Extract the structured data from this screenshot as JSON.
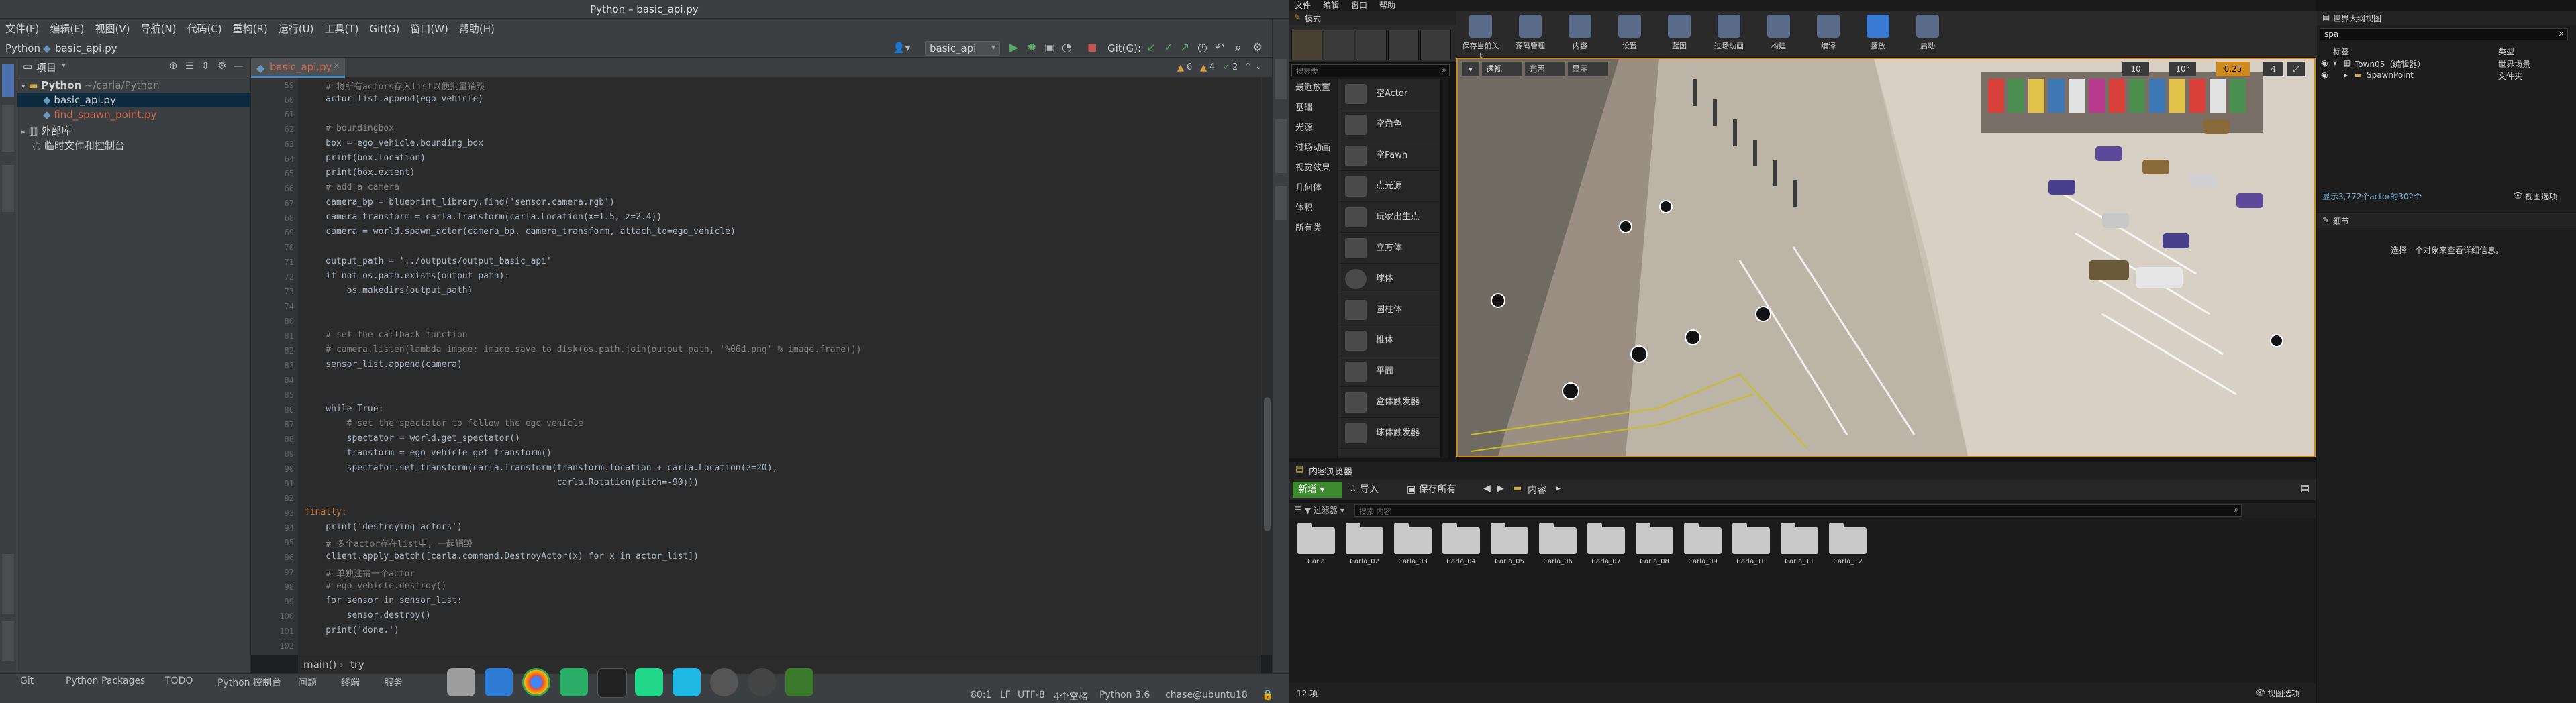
{
  "ide": {
    "window_title": "Python – basic_api.py",
    "menu": [
      "文件(F)",
      "编辑(E)",
      "视图(V)",
      "导航(N)",
      "代码(C)",
      "重构(R)",
      "运行(U)",
      "工具(T)",
      "Git(G)",
      "窗口(W)",
      "帮助(H)"
    ],
    "nav": {
      "project": "Python",
      "file": "basic_api.py",
      "run_config": "basic_api",
      "git_label": "Git(G):"
    },
    "project_panel": {
      "title": "项目",
      "root": "Python",
      "root_path": "~/carla/Python",
      "files": [
        "basic_api.py",
        "find_spawn_point.py"
      ],
      "external": "外部库",
      "scratch": "临时文件和控制台"
    },
    "editor_tab": "basic_api.py",
    "inspection": {
      "warnings": "6",
      "weak": "4",
      "typos": "2"
    },
    "code_lines": [
      {
        "n": "59",
        "t": "    # 将所有actors存入list以便批量销毁",
        "c": "cm"
      },
      {
        "n": "60",
        "t": "    actor_list.append(ego_vehicle)",
        "c": ""
      },
      {
        "n": "61",
        "t": "",
        "c": ""
      },
      {
        "n": "62",
        "t": "    # boundingbox",
        "c": "cm"
      },
      {
        "n": "63",
        "t": "    box = ego_vehicle.bounding_box",
        "c": ""
      },
      {
        "n": "64",
        "t": "    print(box.location)",
        "c": ""
      },
      {
        "n": "65",
        "t": "    print(box.extent)",
        "c": ""
      },
      {
        "n": "66",
        "t": "    # add a camera",
        "c": "cm"
      },
      {
        "n": "67",
        "t": "    camera_bp = blueprint_library.find('sensor.camera.rgb')",
        "c": ""
      },
      {
        "n": "68",
        "t": "    camera_transform = carla.Transform(carla.Location(x=1.5, z=2.4))",
        "c": ""
      },
      {
        "n": "69",
        "t": "    camera = world.spawn_actor(camera_bp, camera_transform, attach_to=ego_vehicle)",
        "c": ""
      },
      {
        "n": "70",
        "t": "",
        "c": ""
      },
      {
        "n": "71",
        "t": "    output_path = '../outputs/output_basic_api'",
        "c": ""
      },
      {
        "n": "72",
        "t": "    if not os.path.exists(output_path):",
        "c": ""
      },
      {
        "n": "73",
        "t": "        os.makedirs(output_path)",
        "c": ""
      },
      {
        "n": "74",
        "t": "",
        "c": ""
      },
      {
        "n": "80",
        "t": "",
        "c": ""
      },
      {
        "n": "81",
        "t": "    # set the callback function",
        "c": "cm"
      },
      {
        "n": "82",
        "t": "    # camera.listen(lambda image: image.save_to_disk(os.path.join(output_path, '%06d.png' % image.frame)))",
        "c": "cm"
      },
      {
        "n": "83",
        "t": "    sensor_list.append(camera)",
        "c": ""
      },
      {
        "n": "84",
        "t": "",
        "c": ""
      },
      {
        "n": "85",
        "t": "",
        "c": ""
      },
      {
        "n": "86",
        "t": "    while True:",
        "c": ""
      },
      {
        "n": "87",
        "t": "        # set the spectator to follow the ego vehicle",
        "c": "cm"
      },
      {
        "n": "88",
        "t": "        spectator = world.get_spectator()",
        "c": ""
      },
      {
        "n": "89",
        "t": "        transform = ego_vehicle.get_transform()",
        "c": ""
      },
      {
        "n": "90",
        "t": "        spectator.set_transform(carla.Transform(transform.location + carla.Location(z=20),",
        "c": ""
      },
      {
        "n": "91",
        "t": "                                                carla.Rotation(pitch=-90)))",
        "c": ""
      },
      {
        "n": "92",
        "t": "",
        "c": ""
      },
      {
        "n": "93",
        "t": "finally:",
        "c": "kw"
      },
      {
        "n": "94",
        "t": "    print('destroying actors')",
        "c": ""
      },
      {
        "n": "95",
        "t": "    # 多个actor存在list中, 一起销毁",
        "c": "cm"
      },
      {
        "n": "96",
        "t": "    client.apply_batch([carla.command.DestroyActor(x) for x in actor_list])",
        "c": ""
      },
      {
        "n": "97",
        "t": "    # 单独注销一个actor",
        "c": "cm"
      },
      {
        "n": "98",
        "t": "    # ego_vehicle.destroy()",
        "c": "cm"
      },
      {
        "n": "99",
        "t": "    for sensor in sensor_list:",
        "c": ""
      },
      {
        "n": "100",
        "t": "        sensor.destroy()",
        "c": ""
      },
      {
        "n": "101",
        "t": "    print('done.')",
        "c": ""
      },
      {
        "n": "102",
        "t": "",
        "c": ""
      }
    ],
    "breadcrumb": [
      "main()",
      "try"
    ],
    "tool_windows": [
      "Git",
      "Python Packages",
      "TODO",
      "Python 控制台",
      "问题",
      "终端",
      "服务"
    ],
    "status": {
      "position": "80:1",
      "line_sep": "LF",
      "encoding": "UTF-8",
      "indent": "4个空格",
      "interpreter": "Python 3.6",
      "user": "chase@ubuntu18"
    }
  },
  "ue": {
    "menu": [
      "文件",
      "编辑",
      "窗口",
      "帮助"
    ],
    "modes_tab": "模式",
    "place_search_placeholder": "搜索类",
    "place_categories": [
      "最近放置",
      "基础",
      "光源",
      "过场动画",
      "视觉效果",
      "几何体",
      "体积",
      "所有类"
    ],
    "place_items": [
      "空Actor",
      "空角色",
      "空Pawn",
      "点光源",
      "玩家出生点",
      "立方体",
      "球体",
      "圆柱体",
      "椎体",
      "平面",
      "盒体触发器",
      "球体触发器"
    ],
    "toolbar": [
      "保存当前关卡",
      "源码管理",
      "内容",
      "设置",
      "蓝图",
      "过场动画",
      "构建",
      "编译",
      "播放",
      "启动"
    ],
    "viewport": {
      "mode_perspective": "透视",
      "mode_lit": "光照",
      "mode_show": "显示",
      "snap_grid": "10",
      "snap_rot": "10°",
      "snap_scale": "0.25",
      "camera_speed": "4"
    },
    "content_browser": {
      "tab": "内容浏览器",
      "add_new": "新增",
      "import": "导入",
      "save_all": "保存所有",
      "path": "内容",
      "filter": "过滤器",
      "search_placeholder": "搜索 内容",
      "folders": [
        "Carla",
        "Carla_02",
        "Carla_03",
        "Carla_04",
        "Carla_05",
        "Carla_06",
        "Carla_07",
        "Carla_08",
        "Carla_09",
        "Carla_10",
        "Carla_11",
        "Carla_12"
      ],
      "item_count": "12 项",
      "view_options": "视图选项"
    },
    "outliner": {
      "tab": "世界大纲视图",
      "search_value": "spa",
      "col_label": "标签",
      "col_type": "类型",
      "rows": [
        {
          "label": "Town05（编辑器）",
          "type": "世界场景"
        },
        {
          "label": "SpawnPoint",
          "type": "文件夹"
        }
      ],
      "summary": "显示3,772个actor的302个",
      "view_options": "视图选项"
    },
    "details": {
      "tab": "细节",
      "hint": "选择一个对象来查看详细信息。"
    }
  }
}
